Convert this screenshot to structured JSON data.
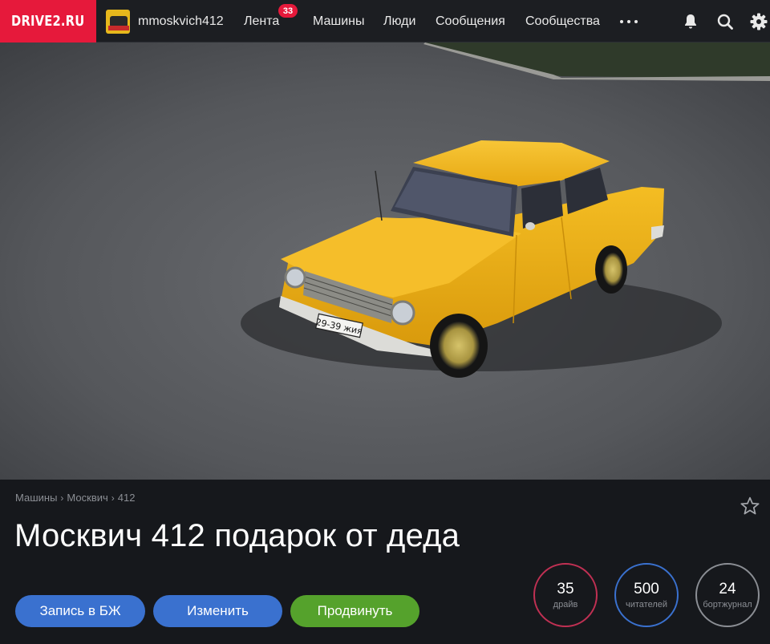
{
  "header": {
    "logo": "DRIVE2.RU",
    "username": "mmoskvich412",
    "nav": [
      {
        "label": "Лента",
        "badge": "33"
      },
      {
        "label": "Машины"
      },
      {
        "label": "Люди"
      },
      {
        "label": "Сообщения"
      },
      {
        "label": "Сообщества"
      }
    ],
    "icons": [
      "more-dots-icon",
      "bell-icon",
      "search-icon",
      "gear-icon"
    ]
  },
  "hero": {
    "plate": "29-39 жия"
  },
  "breadcrumb": [
    "Машины",
    "Москвич",
    "412"
  ],
  "title": "Москвич 412 подарок от деда",
  "buttons": {
    "logbook": "Запись в БЖ",
    "edit": "Изменить",
    "promote": "Продвинуть"
  },
  "stats": [
    {
      "value": "35",
      "label": "драйв",
      "color": "#c03053"
    },
    {
      "value": "500",
      "label": "читателей",
      "color": "#3a71cf"
    },
    {
      "value": "24",
      "label": "бортжурнал",
      "color": "#8b8e94"
    }
  ],
  "colors": {
    "brand": "#e6193b",
    "button_blue": "#3a71cf",
    "button_green": "#55a22c",
    "car": "#f2b51c"
  }
}
